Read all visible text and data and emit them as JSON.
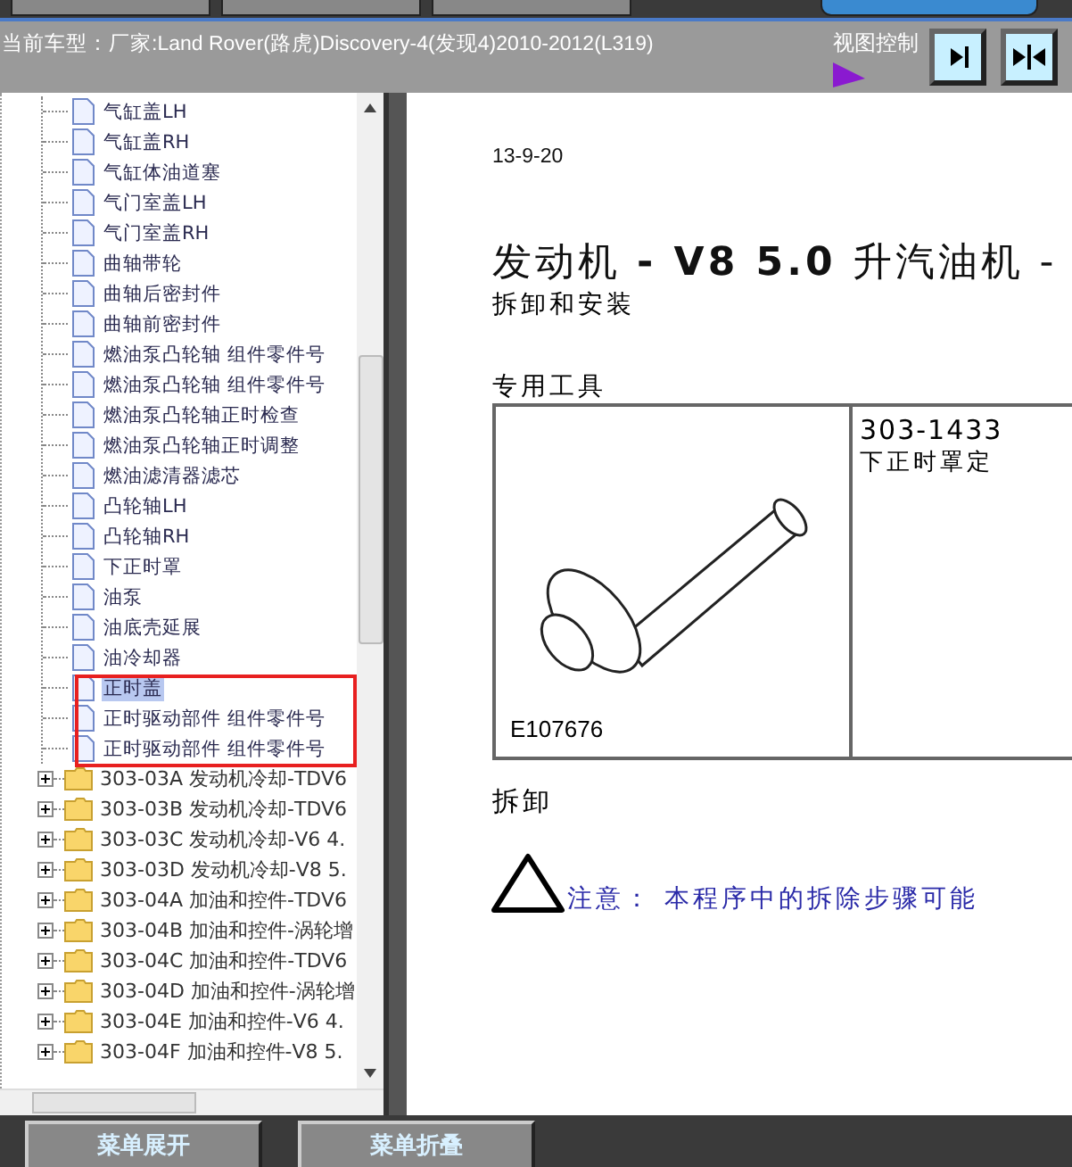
{
  "header": {
    "vehicle": "当前车型：厂家:Land Rover(路虎)Discovery-4(发现4)2010-2012(L319)",
    "view_control": {
      "label": "视图控制"
    }
  },
  "tree": {
    "leaves": [
      {
        "label": "气缸盖LH",
        "selected": false
      },
      {
        "label": "气缸盖RH",
        "selected": false
      },
      {
        "label": "气缸体油道塞",
        "selected": false
      },
      {
        "label": "气门室盖LH",
        "selected": false
      },
      {
        "label": "气门室盖RH",
        "selected": false
      },
      {
        "label": "曲轴带轮",
        "selected": false
      },
      {
        "label": "曲轴后密封件",
        "selected": false
      },
      {
        "label": "曲轴前密封件",
        "selected": false
      },
      {
        "label": "燃油泵凸轮轴 组件零件号",
        "selected": false
      },
      {
        "label": "燃油泵凸轮轴 组件零件号",
        "selected": false
      },
      {
        "label": "燃油泵凸轮轴正时检查",
        "selected": false
      },
      {
        "label": "燃油泵凸轮轴正时调整",
        "selected": false
      },
      {
        "label": "燃油滤清器滤芯",
        "selected": false
      },
      {
        "label": "凸轮轴LH",
        "selected": false
      },
      {
        "label": "凸轮轴RH",
        "selected": false
      },
      {
        "label": "下正时罩",
        "selected": false
      },
      {
        "label": "油泵",
        "selected": false
      },
      {
        "label": "油底壳延展",
        "selected": false
      },
      {
        "label": "油冷却器",
        "selected": false
      },
      {
        "label": "正时盖",
        "selected": true
      },
      {
        "label": "正时驱动部件 组件零件号",
        "selected": false
      },
      {
        "label": "正时驱动部件 组件零件号",
        "selected": false
      }
    ],
    "folders": [
      {
        "label": "303-03A 发动机冷却-TDV6",
        "expanded": false
      },
      {
        "label": "303-03B 发动机冷却-TDV6",
        "expanded": false
      },
      {
        "label": "303-03C 发动机冷却-V6 4.",
        "expanded": false
      },
      {
        "label": "303-03D 发动机冷却-V8 5.",
        "expanded": false
      },
      {
        "label": "303-04A 加油和控件-TDV6",
        "expanded": false
      },
      {
        "label": "303-04B 加油和控件-涡轮增",
        "expanded": false
      },
      {
        "label": "303-04C 加油和控件-TDV6",
        "expanded": false
      },
      {
        "label": "303-04D 加油和控件-涡轮增",
        "expanded": false
      },
      {
        "label": "303-04E 加油和控件-V6 4.",
        "expanded": false
      },
      {
        "label": "303-04F 加油和控件-V8 5.",
        "expanded": false
      }
    ]
  },
  "document": {
    "date": "13-9-20",
    "title": "发动机 **- V8 5.0** 升汽油机 -",
    "subtitle": "拆卸和安装",
    "tools_heading": "专用工具",
    "tool": {
      "figure_label": "E107676",
      "number": "303-1433",
      "name": "下正时罩定"
    },
    "section": "拆卸",
    "caution": "注意： 本程序中的拆除步骤可能"
  },
  "buttons": [
    {
      "label": "菜单展开"
    },
    {
      "label": "菜单折叠"
    }
  ]
}
